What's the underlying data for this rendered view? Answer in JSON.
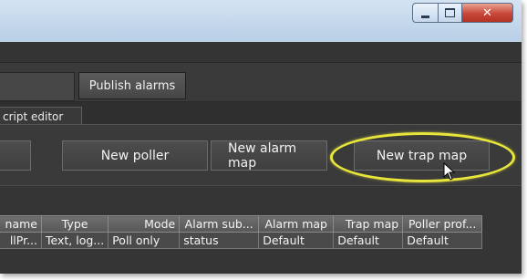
{
  "window": {
    "title_buttons": {
      "minimize_icon": "minimize-icon",
      "maximize_icon": "maximize-icon",
      "close_icon": "close-icon",
      "close_glyph": "✕"
    }
  },
  "toolbar": {
    "publish_alarms_label": "Publish alarms"
  },
  "tabs": [
    {
      "label": "cript editor",
      "selected": true
    }
  ],
  "actions": {
    "new_poller_label": "New poller",
    "new_alarm_map_label": "New alarm map",
    "new_trap_map_label": "New trap map"
  },
  "highlight_color": "#e8e63a",
  "table": {
    "columns": [
      "name",
      "Type",
      "Mode",
      "Alarm sub...",
      "Alarm map",
      "Trap map",
      "Poller prof..."
    ],
    "rows": [
      [
        "llPr...",
        "Text, log...",
        "Poll only",
        "status",
        "Default",
        "Default",
        "Default"
      ]
    ]
  }
}
